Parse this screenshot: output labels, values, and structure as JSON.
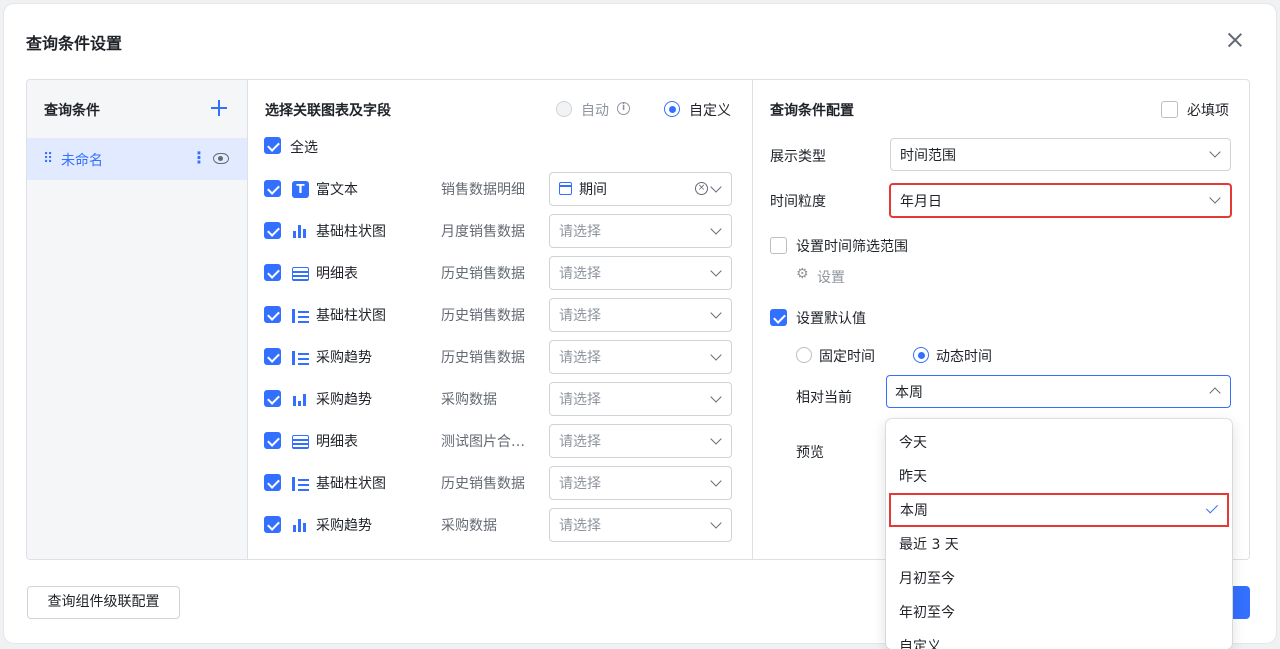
{
  "dialog": {
    "title": "查询条件设置"
  },
  "left_panel": {
    "title": "查询条件",
    "items": [
      {
        "label": "未命名"
      }
    ]
  },
  "middle_panel": {
    "title": "选择关联图表及字段",
    "mode_auto": "自动",
    "mode_custom": "自定义",
    "mode_selected": "自定义",
    "select_all": "全选",
    "rows": [
      {
        "icon": "rich-text-icon",
        "name": "富文本",
        "source": "销售数据明细",
        "field": "期间",
        "placeholder": ""
      },
      {
        "icon": "bar-chart-icon",
        "name": "基础柱状图",
        "source": "月度销售数据",
        "field": "",
        "placeholder": "请选择"
      },
      {
        "icon": "table-icon",
        "name": "明细表",
        "source": "历史销售数据",
        "field": "",
        "placeholder": "请选择"
      },
      {
        "icon": "horizontal-bar-icon",
        "name": "基础柱状图",
        "source": "历史销售数据",
        "field": "",
        "placeholder": "请选择"
      },
      {
        "icon": "horizontal-bar-icon",
        "name": "采购趋势",
        "source": "历史销售数据",
        "field": "",
        "placeholder": "请选择"
      },
      {
        "icon": "combo-chart-icon",
        "name": "采购趋势",
        "source": "采购数据",
        "field": "",
        "placeholder": "请选择"
      },
      {
        "icon": "table-icon",
        "name": "明细表",
        "source": "测试图片合…",
        "field": "",
        "placeholder": "请选择"
      },
      {
        "icon": "horizontal-bar-icon",
        "name": "基础柱状图",
        "source": "历史销售数据",
        "field": "",
        "placeholder": "请选择"
      },
      {
        "icon": "bar-chart-icon",
        "name": "采购趋势",
        "source": "采购数据",
        "field": "",
        "placeholder": "请选择"
      }
    ]
  },
  "right_panel": {
    "title": "查询条件配置",
    "required_label": "必填项",
    "display_type_label": "展示类型",
    "display_type_value": "时间范围",
    "granularity_label": "时间粒度",
    "granularity_value": "年月日",
    "filter_range_label": "设置时间筛选范围",
    "settings_link": "设置",
    "default_value_label": "设置默认值",
    "fixed_time": "固定时间",
    "dynamic_time": "动态时间",
    "relative_label": "相对当前",
    "relative_value": "本周",
    "preview_label": "预览"
  },
  "dropdown": {
    "options": [
      "今天",
      "昨天",
      "本周",
      "最近 3 天",
      "月初至今",
      "年初至今",
      "自定义"
    ],
    "selected": "本周"
  },
  "footer": {
    "cascade_button": "查询组件级联配置"
  },
  "colors": {
    "accent": "#3370ff",
    "highlight": "#e53935",
    "selected_bg": "#e1eaff"
  }
}
